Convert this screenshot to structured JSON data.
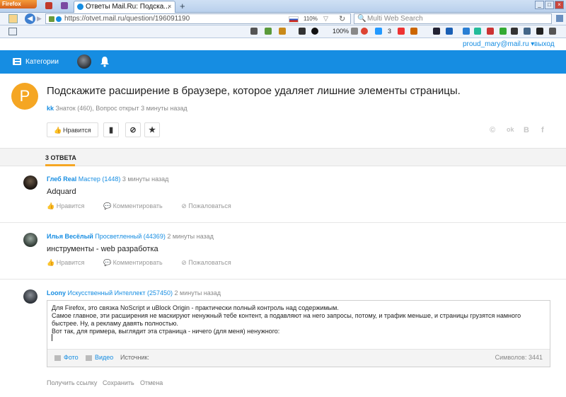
{
  "browser": {
    "app_button": "Firefox",
    "tabs": [
      {
        "title": "",
        "active": false
      },
      {
        "title": "Ответы Mail.Ru: Подска...",
        "active": true
      }
    ],
    "new_tab": "+",
    "window_buttons": [
      "_",
      "□",
      "×"
    ],
    "url": "https://otvet.mail.ru/question/196091190",
    "zoom": "110%",
    "search_placeholder": "Multi Web Search",
    "toolbar_zoom": "100%",
    "toolbar_count": "3"
  },
  "user": {
    "email": "proud_mary@mail.ru ▾",
    "logout": "выход"
  },
  "header": {
    "categories": "Категории"
  },
  "question": {
    "avatar_letter": "P",
    "title": "Подскажите расширение в браузере, которое удаляет лишние элементы страницы.",
    "author": "kk",
    "meta": " Знаток (460), Вопрос открыт 3 минуты назад",
    "like_label": "Нравится",
    "share": [
      "©",
      "ok",
      "В",
      "f"
    ]
  },
  "answers_header": "3 ОТВЕТА",
  "answers": [
    {
      "nick": "Глеб Real",
      "rank": " Мастер (1448)",
      "time": " 3 минуты назад",
      "text": "Adquard",
      "actions": [
        "Нравится",
        "Комментировать",
        "Пожаловаться"
      ]
    },
    {
      "nick": "Илья Весёлый",
      "rank": " Просветленный (44369)",
      "time": " 2 минуты назад",
      "text": "инструменты - web разработка",
      "actions": [
        "Нравится",
        "Комментировать",
        "Пожаловаться"
      ]
    },
    {
      "nick": "Loony",
      "rank": " Искусственный Интеллект (257450)",
      "time": " 2 минуты назад"
    }
  ],
  "editor": {
    "lines": [
      "Для Firefox, это связка NoScript и uBlock Origin - практически полный контроль над содержимым.",
      "Самое главное, эти расширения не маскируют ненужный тебе контент, а подавляют на него запросы, потому, и трафик меньше, и страницы грузятся намного",
      "быстрее. Ну, а рекламу давять полностью.",
      "Вот так, для примера, выглядит эта страница - ничего (для меня) ненужного:"
    ],
    "photo": "Фото",
    "video": "Видео",
    "source": "Источник:",
    "chars": "Символов: 3441"
  },
  "bottom_links": [
    "Получить ссылку",
    "Сохранить",
    "Отмена"
  ],
  "colors": {
    "accent": "#168de2",
    "avatar": "#f5a623"
  }
}
